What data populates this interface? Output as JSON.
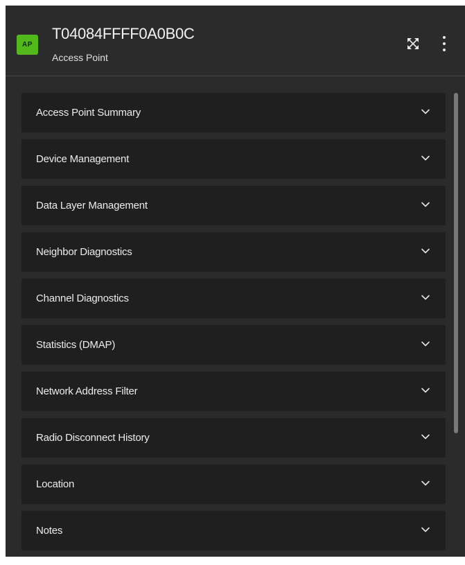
{
  "header": {
    "badge": "AP",
    "title": "T04084FFFF0A0B0C",
    "subtitle": "Access Point"
  },
  "icons": {
    "expand": "expand-arrows-icon",
    "menu": "vertical-dots-icon",
    "chevron": "chevron-down-icon"
  },
  "colors": {
    "badge": "#52b81c",
    "panel": "#2b2b2b",
    "item": "#1f1f1f"
  },
  "sections": [
    {
      "label": "Access Point Summary"
    },
    {
      "label": "Device Management"
    },
    {
      "label": "Data Layer Management"
    },
    {
      "label": "Neighbor Diagnostics"
    },
    {
      "label": "Channel Diagnostics"
    },
    {
      "label": "Statistics (DMAP)"
    },
    {
      "label": "Network Address Filter"
    },
    {
      "label": "Radio Disconnect History"
    },
    {
      "label": "Location"
    },
    {
      "label": "Notes"
    }
  ]
}
